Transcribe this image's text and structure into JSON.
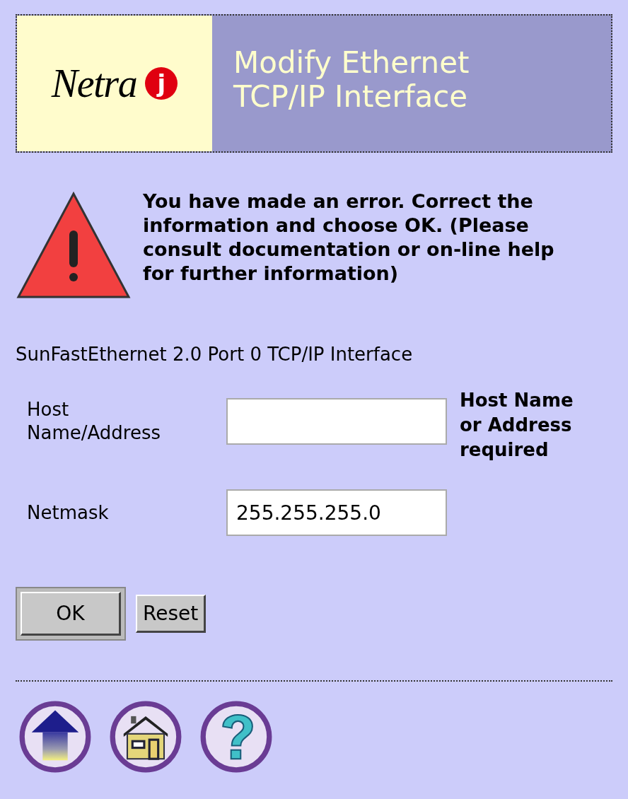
{
  "header": {
    "logo": "Netra",
    "logo_badge": "j",
    "title_lines": [
      "Modify Ethernet",
      "TCP/IP Interface"
    ]
  },
  "error_message": "You have made an error. Correct the information and choose OK. (Please consult documentation or on-line help for further information)",
  "interface_name": "SunFastEthernet 2.0 Port 0 TCP/IP Interface",
  "fields": [
    {
      "label": "Host Name/Address",
      "error": "Host Name or Address required"
    },
    {
      "label": "Netmask",
      "value": "255.255.255.0"
    }
  ],
  "buttons": [
    {
      "label": "OK",
      "default": true
    },
    {
      "label": "Reset",
      "default": false
    }
  ],
  "nav_icons": [
    {
      "kind": "up"
    },
    {
      "kind": "home"
    },
    {
      "kind": "help"
    }
  ]
}
